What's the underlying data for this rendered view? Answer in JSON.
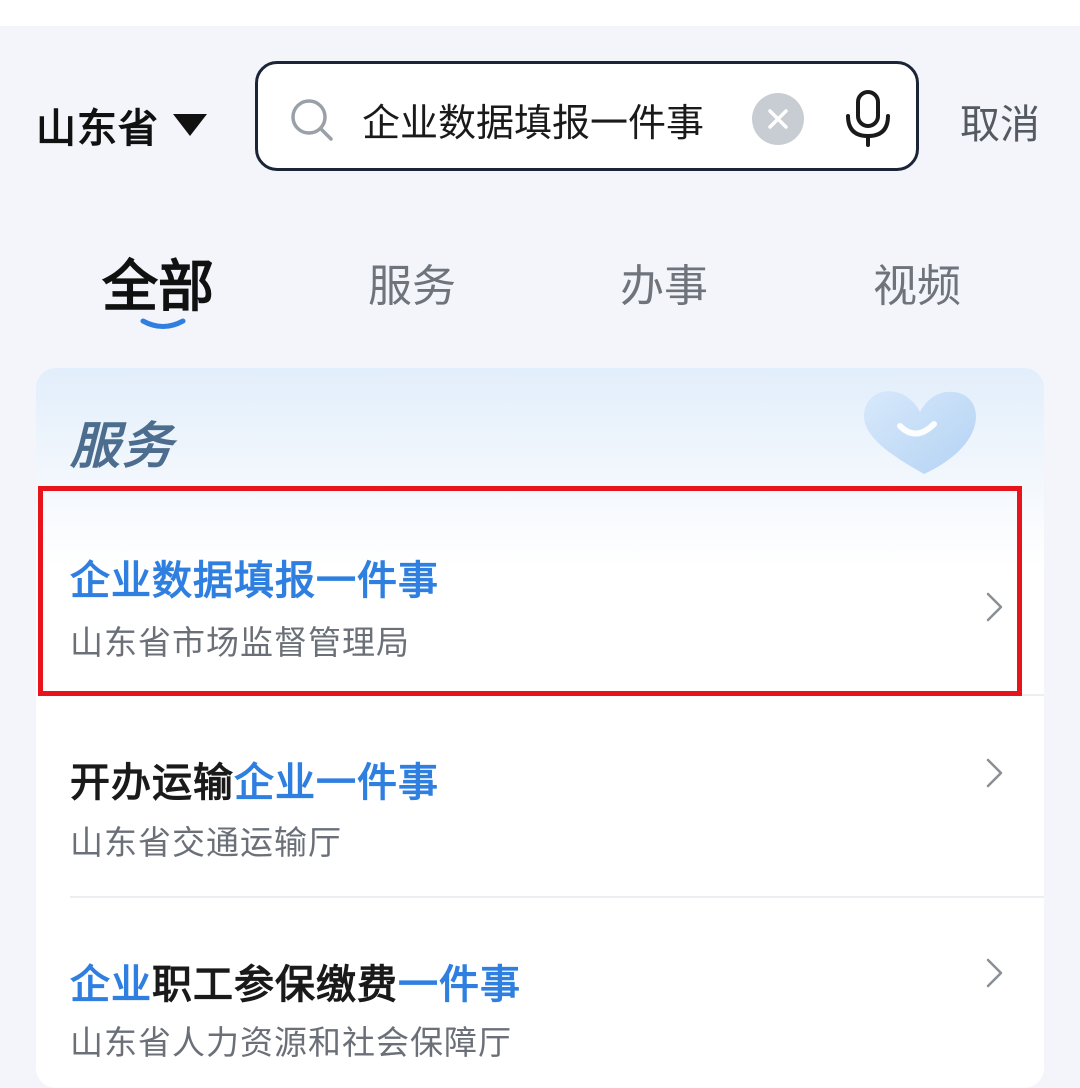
{
  "header": {
    "region_label": "山东省",
    "search_value": "企业数据填报一件事",
    "cancel_label": "取消"
  },
  "tabs": [
    {
      "label": "全部",
      "active": true
    },
    {
      "label": "服务",
      "active": false
    },
    {
      "label": "办事",
      "active": false
    },
    {
      "label": "视频",
      "active": false
    }
  ],
  "section": {
    "title": "服务",
    "results": [
      {
        "title_parts": [
          "",
          "企业数据填报一件事",
          ""
        ],
        "department": "山东省市场监督管理局",
        "selected": true
      },
      {
        "title_parts": [
          "开办运输",
          "企业一件事",
          ""
        ],
        "department": "山东省交通运输厅",
        "selected": false
      },
      {
        "title_parts": [
          "",
          "企业",
          "职工参保缴费",
          "一件事"
        ],
        "department": "山东省人力资源和社会保障厅",
        "selected": false
      }
    ]
  },
  "colors": {
    "accent": "#2f7fe0",
    "highlight_border": "#e8141c",
    "background": "#f3f5fa"
  },
  "icons": [
    "search-icon",
    "clear-icon",
    "microphone-icon",
    "caret-down-icon",
    "chevron-right-icon",
    "heart-chat-icon"
  ]
}
